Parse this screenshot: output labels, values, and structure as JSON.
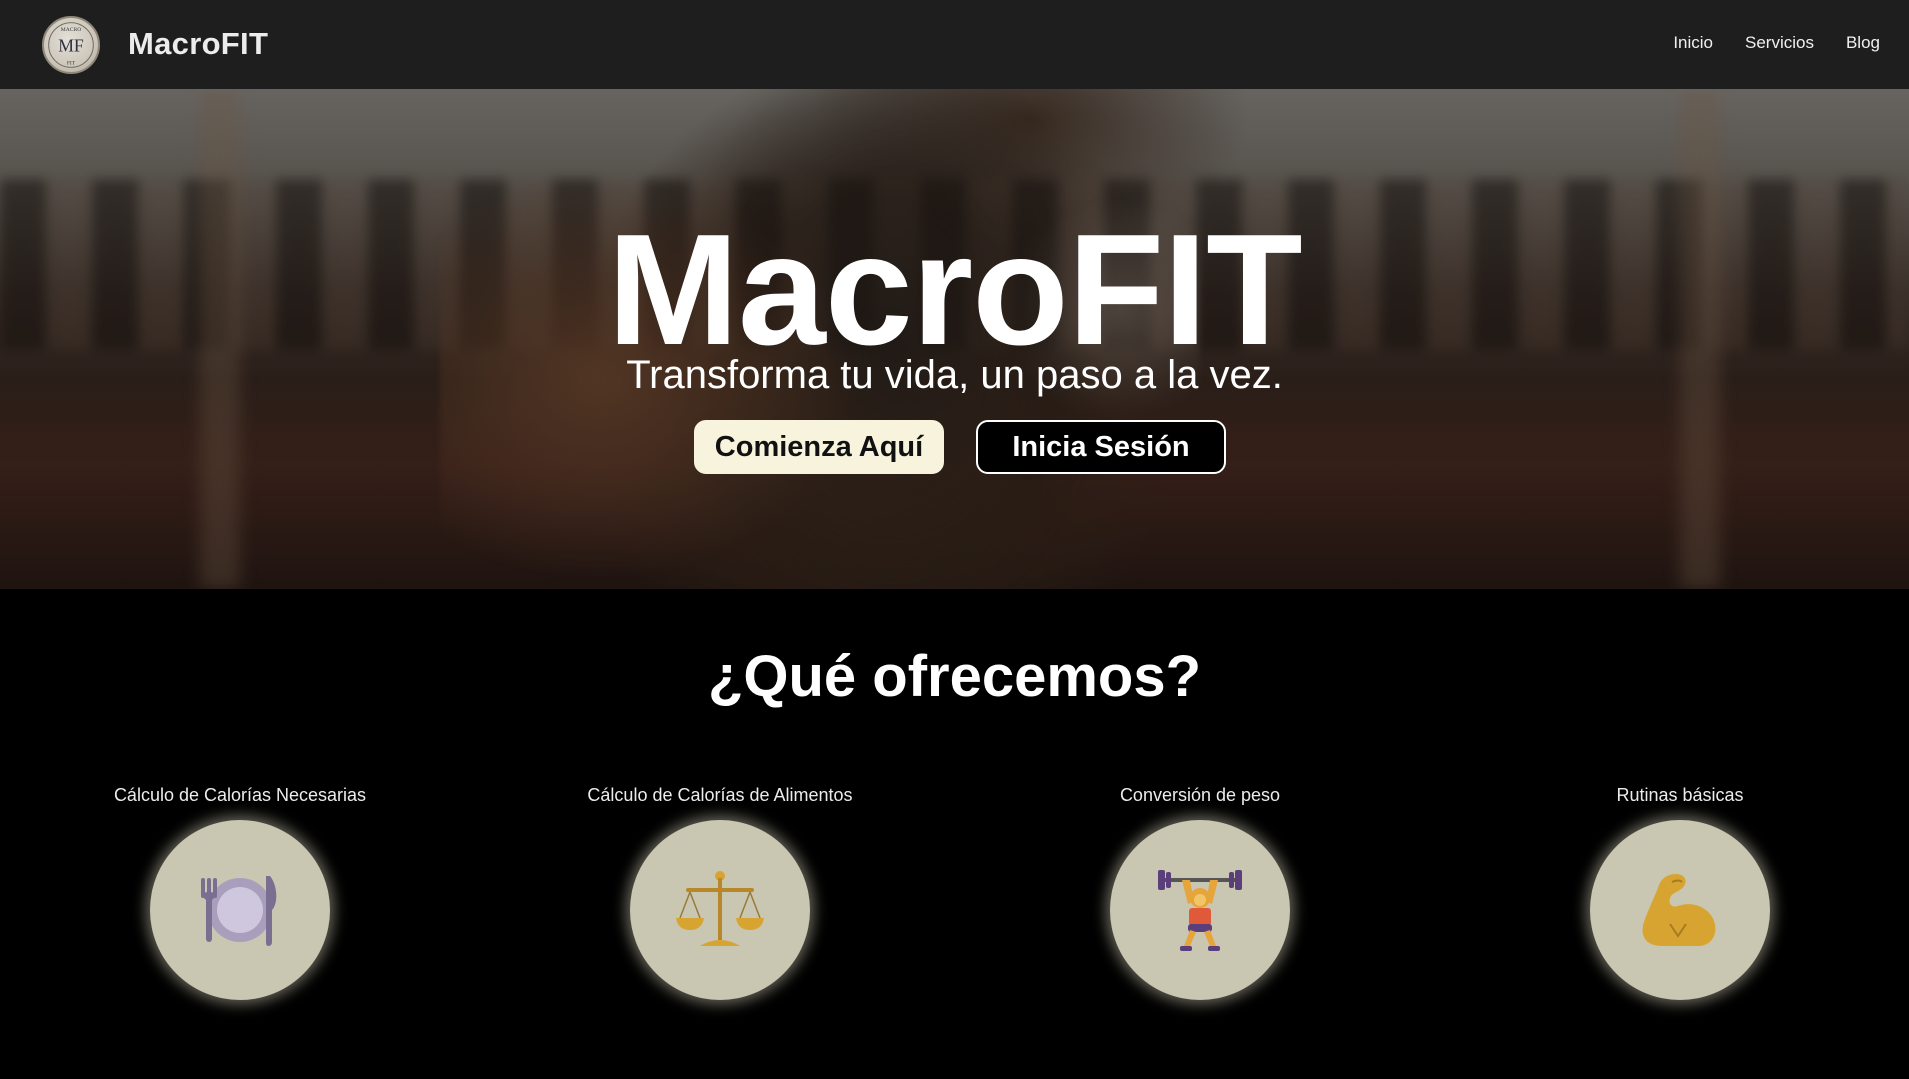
{
  "app": {
    "brand": "MacroFIT",
    "logo": {
      "top": "MACRO",
      "monogram": "MF",
      "bottom": "FIT"
    }
  },
  "nav": {
    "items": [
      {
        "label": "Inicio"
      },
      {
        "label": "Servicios"
      },
      {
        "label": "Blog"
      }
    ]
  },
  "hero": {
    "title": "MacroFIT",
    "subtitle": "Transforma tu vida, un paso a la vez.",
    "primary_button": "Comienza Aquí",
    "secondary_button": "Inicia Sesión"
  },
  "services": {
    "title": "¿Qué ofrecemos?",
    "cards": [
      {
        "label": "Cálculo de Calorías Necesarias",
        "icon": "plate-utensils-icon"
      },
      {
        "label": "Cálculo de Calorías de Alimentos",
        "icon": "balance-scale-icon"
      },
      {
        "label": "Conversión de peso",
        "icon": "weightlifter-icon"
      },
      {
        "label": "Rutinas básicas",
        "icon": "flexed-bicep-icon"
      }
    ]
  },
  "colors": {
    "topbar": "#1e1e1e",
    "primary_button_bg": "#f7f3dc",
    "card_circle": "#c9c6b1",
    "icon_gold": "#d8a431",
    "icon_purple": "#7a6e91"
  }
}
